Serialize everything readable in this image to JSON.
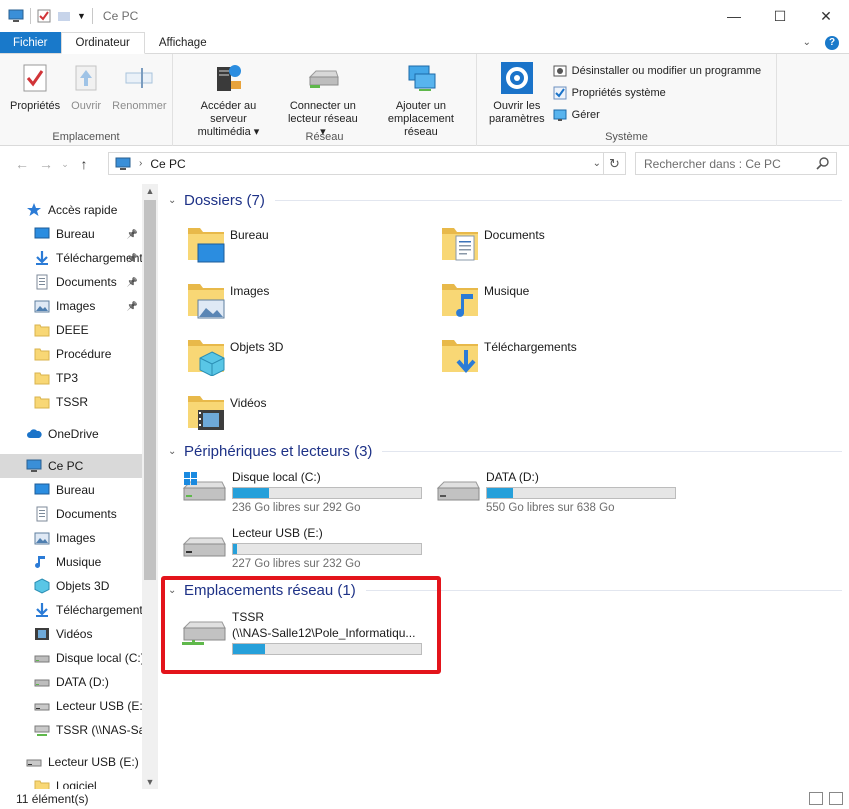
{
  "window": {
    "title": "Ce PC"
  },
  "ribbon_tabs": [
    "Fichier",
    "Ordinateur",
    "Affichage"
  ],
  "ribbon": {
    "groups": {
      "emplacement": {
        "label": "Emplacement",
        "proprietes": "Propriétés",
        "ouvrir": "Ouvrir",
        "renommer": "Renommer"
      },
      "reseau": {
        "label": "Réseau",
        "acceder_l1": "Accéder au serveur",
        "acceder_l2": "multimédia",
        "connecter_l1": "Connecter un",
        "connecter_l2": "lecteur réseau",
        "ajouter_l1": "Ajouter un",
        "ajouter_l2": "emplacement réseau"
      },
      "systeme": {
        "label": "Système",
        "ouvrir_params_l1": "Ouvrir les",
        "ouvrir_params_l2": "paramètres",
        "desinstaller": "Désinstaller ou modifier un programme",
        "proprietes_systeme": "Propriétés système",
        "gerer": "Gérer"
      }
    }
  },
  "address": {
    "location": "Ce PC",
    "search_placeholder": "Rechercher dans : Ce PC"
  },
  "sidebar": {
    "items": [
      {
        "label": "Accès rapide",
        "icon": "star-icon",
        "level": 1,
        "pinned": false
      },
      {
        "label": "Bureau",
        "icon": "desktop-icon",
        "level": 2,
        "pinned": true
      },
      {
        "label": "Téléchargements",
        "icon": "download-icon",
        "level": 2,
        "pinned": true
      },
      {
        "label": "Documents",
        "icon": "document-icon",
        "level": 2,
        "pinned": true
      },
      {
        "label": "Images",
        "icon": "image-icon",
        "level": 2,
        "pinned": true
      },
      {
        "label": "DEEE",
        "icon": "folder-icon",
        "level": 2,
        "pinned": false
      },
      {
        "label": "Procédure",
        "icon": "folder-icon",
        "level": 2,
        "pinned": false
      },
      {
        "label": "TP3",
        "icon": "folder-icon",
        "level": 2,
        "pinned": false
      },
      {
        "label": "TSSR",
        "icon": "folder-icon",
        "level": 2,
        "pinned": false
      },
      {
        "label": "OneDrive",
        "icon": "cloud-icon",
        "level": 1,
        "pinned": false
      },
      {
        "label": "Ce PC",
        "icon": "computer-icon",
        "level": 1,
        "pinned": false,
        "selected": true
      },
      {
        "label": "Bureau",
        "icon": "desktop-icon",
        "level": 2,
        "pinned": false
      },
      {
        "label": "Documents",
        "icon": "document-icon",
        "level": 2,
        "pinned": false
      },
      {
        "label": "Images",
        "icon": "image-icon",
        "level": 2,
        "pinned": false
      },
      {
        "label": "Musique",
        "icon": "music-icon",
        "level": 2,
        "pinned": false
      },
      {
        "label": "Objets 3D",
        "icon": "cube-icon",
        "level": 2,
        "pinned": false
      },
      {
        "label": "Téléchargements",
        "icon": "download-icon",
        "level": 2,
        "pinned": false
      },
      {
        "label": "Vidéos",
        "icon": "video-icon",
        "level": 2,
        "pinned": false
      },
      {
        "label": "Disque local (C:)",
        "icon": "drive-icon",
        "level": 2,
        "pinned": false
      },
      {
        "label": "DATA (D:)",
        "icon": "drive-icon",
        "level": 2,
        "pinned": false
      },
      {
        "label": "Lecteur USB (E:)",
        "icon": "usb-drive-icon",
        "level": 2,
        "pinned": false
      },
      {
        "label": "TSSR (\\\\NAS-Sal",
        "icon": "network-drive-icon",
        "level": 2,
        "pinned": false
      },
      {
        "label": "Lecteur USB (E:)",
        "icon": "usb-drive-icon",
        "level": 1,
        "pinned": false
      },
      {
        "label": "Logiciel",
        "icon": "folder-icon",
        "level": 2,
        "pinned": false
      }
    ]
  },
  "sections": {
    "folders": {
      "title": "Dossiers (7)"
    },
    "devices": {
      "title": "Périphériques et lecteurs (3)"
    },
    "network": {
      "title": "Emplacements réseau (1)"
    }
  },
  "folders": [
    {
      "name": "Bureau",
      "icon": "desktop-folder-icon"
    },
    {
      "name": "Documents",
      "icon": "documents-folder-icon"
    },
    {
      "name": "Images",
      "icon": "images-folder-icon"
    },
    {
      "name": "Musique",
      "icon": "music-folder-icon"
    },
    {
      "name": "Objets 3D",
      "icon": "objects3d-folder-icon"
    },
    {
      "name": "Téléchargements",
      "icon": "downloads-folder-icon"
    },
    {
      "name": "Vidéos",
      "icon": "videos-folder-icon"
    }
  ],
  "drives": [
    {
      "name": "Disque local (C:)",
      "free": "236 Go libres sur 292 Go",
      "used_fraction": 0.19,
      "icon": "windows-drive-icon"
    },
    {
      "name": "DATA (D:)",
      "free": "550 Go libres sur 638 Go",
      "used_fraction": 0.14,
      "icon": "drive-icon"
    },
    {
      "name": "Lecteur USB (E:)",
      "free": "227 Go libres sur 232 Go",
      "used_fraction": 0.02,
      "icon": "usb-drive-icon"
    }
  ],
  "network_drives": [
    {
      "name": "TSSR",
      "path": "(\\\\NAS-Salle12\\Pole_Informatiqu...",
      "used_fraction": 0.17,
      "icon": "network-drive-icon"
    }
  ],
  "status": {
    "count": "11 élément(s)"
  },
  "colors": {
    "accent": "#1979ca",
    "bar_fill": "#26a0da",
    "section_title": "#1e3287",
    "highlight": "#e3141b"
  }
}
